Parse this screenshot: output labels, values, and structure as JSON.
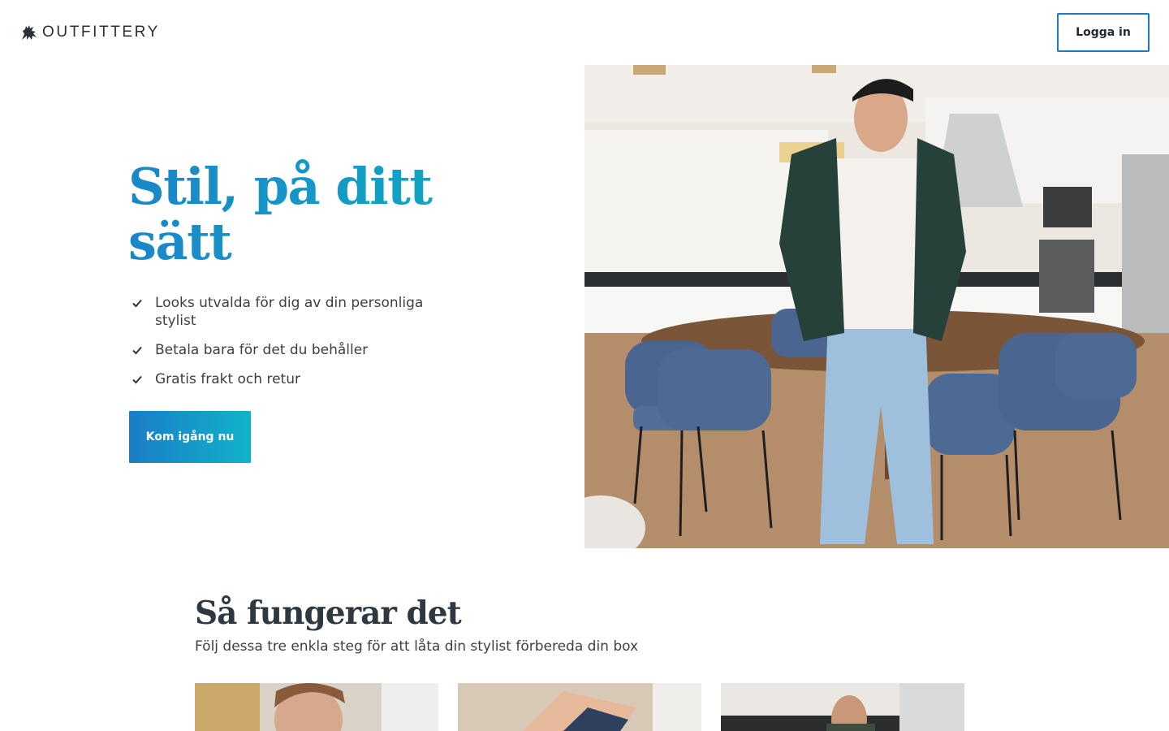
{
  "header": {
    "brand": "OUTFITTERY",
    "login_label": "Logga in"
  },
  "hero": {
    "title": "Stil, på ditt sätt",
    "usps": [
      "Looks utvalda för dig av din personliga stylist",
      "Betala bara för det du behåller",
      "Gratis frakt och retur"
    ],
    "cta_label": "Kom igång nu"
  },
  "how_it_works": {
    "title": "Så fungerar det",
    "subtitle": "Följ dessa tre enkla steg för att låta din stylist förbereda din box"
  },
  "icons": {
    "logo": "griffin-logo-icon",
    "usp": "check-icon"
  },
  "colors": {
    "accent_start": "#1a86c9",
    "accent_end": "#10a8c2",
    "text_dark": "#2e3840"
  }
}
